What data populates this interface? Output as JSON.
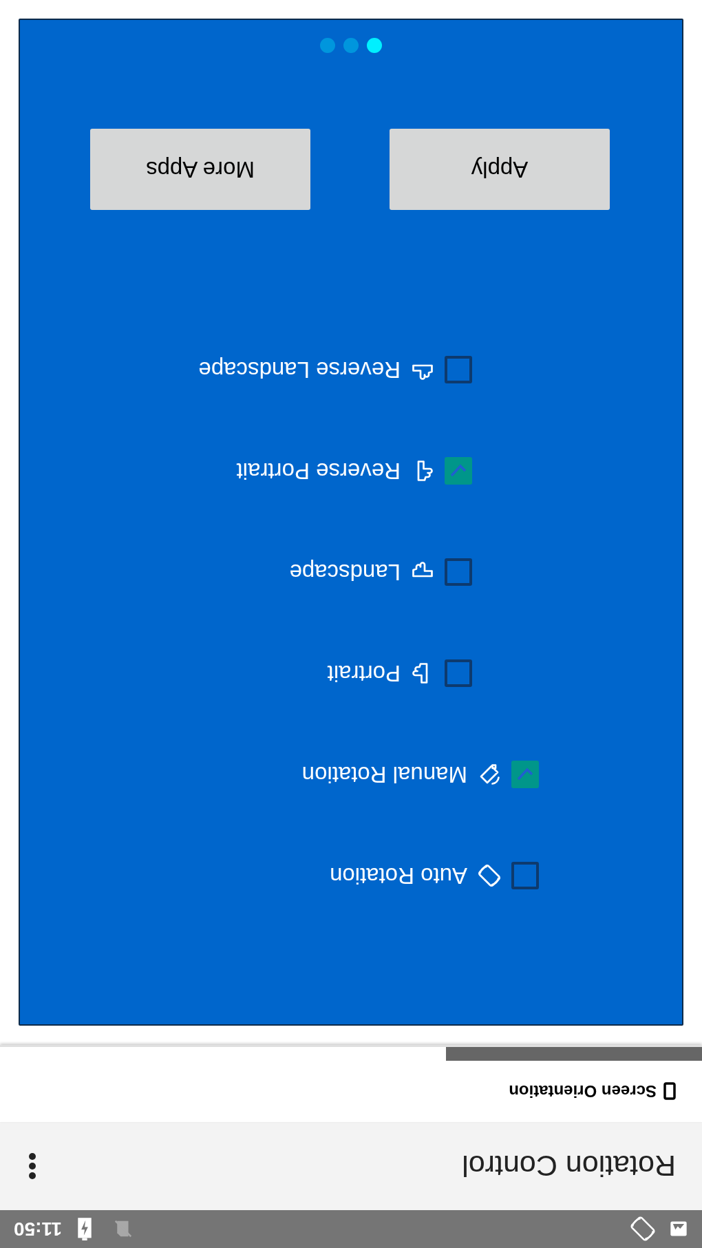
{
  "status_bar": {
    "time": "11:50"
  },
  "app_bar": {
    "title": "Rotation Control"
  },
  "tabs": [
    {
      "label": "Screen Orientation",
      "selected": true
    }
  ],
  "options": [
    {
      "label": "Auto Rotation",
      "checked": false
    },
    {
      "label": "Manual Rotation",
      "checked": true,
      "children": [
        {
          "label": "Portrait",
          "checked": false
        },
        {
          "label": "Landscape",
          "checked": false
        },
        {
          "label": "Reverse Portrait",
          "checked": true
        },
        {
          "label": "Reverse Landscape",
          "checked": false
        }
      ]
    }
  ],
  "buttons": [
    "Apply",
    "More Apps"
  ],
  "pager": [
    {
      "selected": true
    },
    {
      "selected": false
    },
    {
      "selected": false
    }
  ]
}
